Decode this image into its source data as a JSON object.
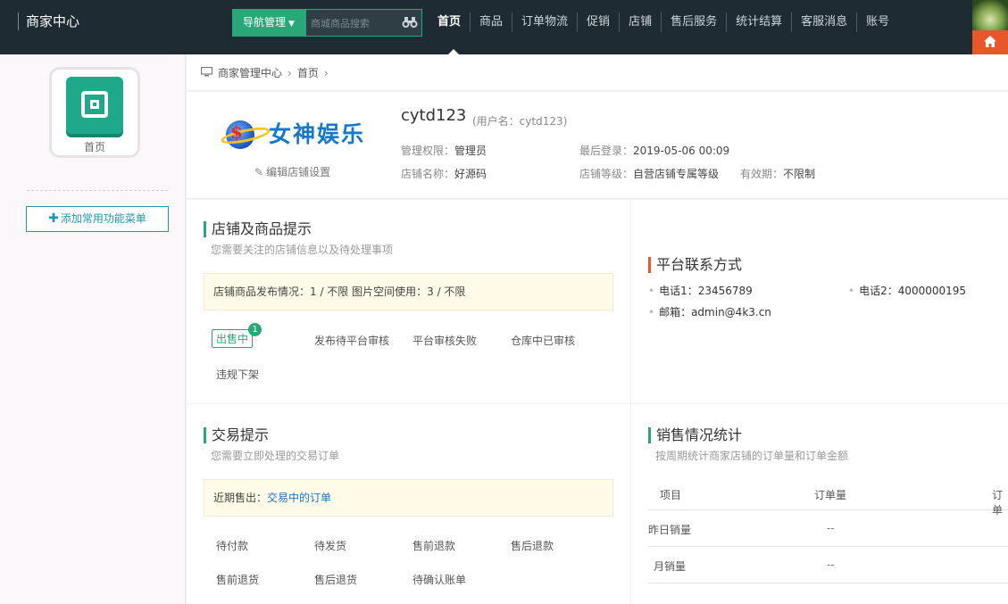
{
  "topbar": {
    "brand": "商家中心",
    "nav_toggle": "导航管理",
    "search_placeholder": "商城商品搜索",
    "menu": [
      "首页",
      "商品",
      "订单物流",
      "促销",
      "店铺",
      "售后服务",
      "统计结算",
      "客服消息",
      "账号"
    ],
    "active_menu": "首页"
  },
  "sidebar": {
    "app_label": "首页",
    "add_menu": "添加常用功能菜单"
  },
  "breadcrumb": [
    "商家管理中心",
    "首页"
  ],
  "profile": {
    "logo_text": "女神娱乐",
    "edit_store": "编辑店铺设置",
    "shop_name": "cytd123",
    "user_name": "(用户名：cytd123)",
    "permission_label": "管理权限：",
    "permission_value": "管理员",
    "last_login_label": "最后登录：",
    "last_login_value": "2019-05-06 00:09",
    "store_name_label": "店铺名称：",
    "store_name_value": "好源码",
    "store_level_label": "店铺等级：",
    "store_level_value": "自营店铺专属等级",
    "validity_label": "有效期：",
    "validity_value": "不限制"
  },
  "store_tips": {
    "title": "店铺及商品提示",
    "subtitle": "您需要关注的店铺信息以及待处理事项",
    "notice": "店铺商品发布情况：1 /  不限      图片空间使用：3 / 不限",
    "tabs": [
      "出售中",
      "发布待平台审核",
      "平台审核失败",
      "仓库中已审核",
      "违规下架"
    ],
    "badge": "1"
  },
  "contact": {
    "title": "平台联系方式",
    "phone1": "电话1：23456789",
    "phone2": "电话2：4000000195",
    "email": "邮箱：admin@4k3.cn"
  },
  "trade_tips": {
    "title": "交易提示",
    "subtitle": "您需要立即处理的交易订单",
    "notice_prefix": "近期售出：",
    "notice_link": "交易中的订单",
    "items": [
      "待付款",
      "待发货",
      "售前退款",
      "售后退款",
      "售前退货",
      "售后退货",
      "待确认账单"
    ]
  },
  "sales": {
    "title": "销售情况统计",
    "subtitle": "按周期统计商家店铺的订单量和订单金额",
    "headers": [
      "项目",
      "订单量",
      "订单"
    ],
    "rows": [
      {
        "label": "昨日销量",
        "value": "--"
      },
      {
        "label": "月销量",
        "value": "--"
      }
    ]
  },
  "colors": {
    "topbar": "#1f2b33",
    "accent_green": "#27a876",
    "accent_orange": "#e8562a",
    "link_blue": "#1a72c7"
  }
}
